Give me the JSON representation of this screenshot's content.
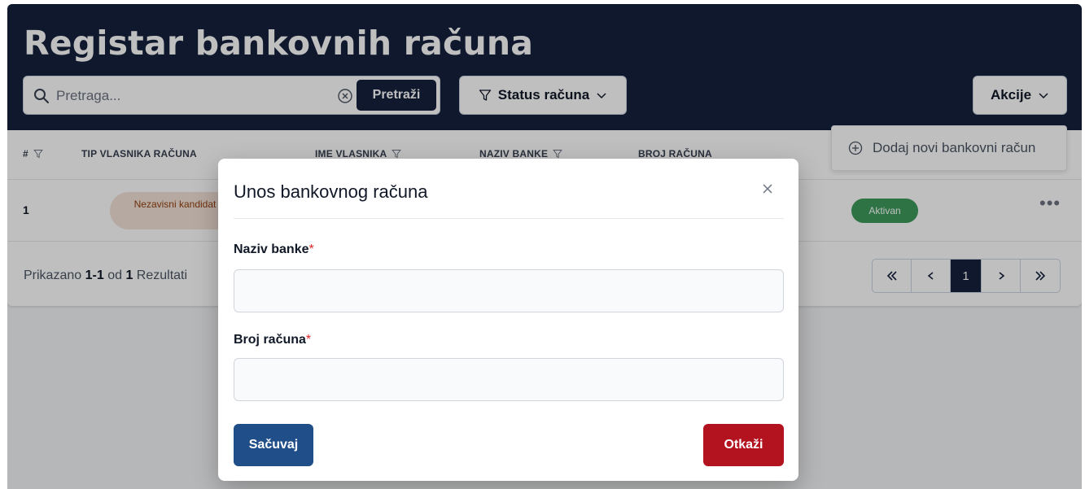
{
  "page": {
    "title": "Registar bankovnih računa"
  },
  "search": {
    "placeholder": "Pretraga...",
    "button_label": "Pretraži"
  },
  "filters": {
    "status_label": "Status računa"
  },
  "actions": {
    "label": "Akcije",
    "menu_items": [
      {
        "label": "Dodaj novi bankovni račun",
        "icon": "plus-circle-icon"
      }
    ]
  },
  "table": {
    "columns": [
      "#",
      "TIP VLASNIKA RAČUNA",
      "IME VLASNIKA",
      "NAZIV BANKE",
      "BROJ RAČUNA"
    ],
    "rows": [
      {
        "num": "1",
        "owner_type": "Nezavisni kandidat",
        "status": "Aktivan"
      }
    ]
  },
  "results": {
    "prefix": "Prikazano",
    "range": "1-1",
    "middle": "od",
    "total": "1",
    "suffix": "Rezultati"
  },
  "pagination": {
    "current_page": "1"
  },
  "modal": {
    "title": "Unos bankovnog računa",
    "fields": [
      {
        "label": "Naziv banke",
        "required_mark": "*",
        "value": ""
      },
      {
        "label": "Broj računa",
        "required_mark": "*",
        "value": ""
      }
    ],
    "save_label": "Sačuvaj",
    "cancel_label": "Otkaži"
  },
  "colors": {
    "header_bg": "#14213d",
    "save_button": "#1f4e89",
    "cancel_button": "#b3121f",
    "status_active": "#3d9a5b",
    "owner_type_badge": "#f3e2d7"
  }
}
